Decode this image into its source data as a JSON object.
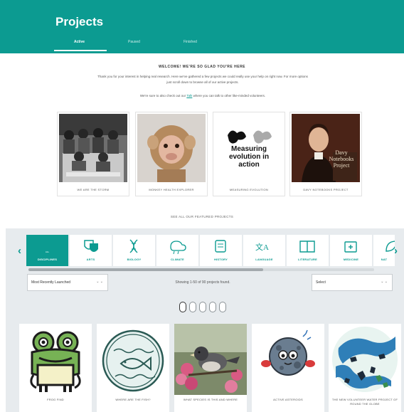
{
  "header": {
    "title": "Projects",
    "tabs": [
      {
        "label": "Active"
      },
      {
        "label": "Paused"
      },
      {
        "label": "Finished"
      }
    ]
  },
  "welcome": {
    "heading": "WELCOME! WE'RE SO GLAD YOU'RE HERE",
    "text": "Thank you for your interest in helping real research. Here we've gathered a few projects we could really use your help on right now. For more options just scroll down to browse all of our active projects.",
    "text2_before": "We're sure to also check out our",
    "text2_link": "Talk",
    "text2_after": "where you can talk to other like-minded volunteers."
  },
  "featured": [
    {
      "label": "WE ARE THE STORM"
    },
    {
      "label": "MONKEY HEALTH EXPLORER"
    },
    {
      "label": "MEASURING EVOLUTION",
      "image_title": "Measuring evolution in action"
    },
    {
      "label": "DAVY NOTEBOOKS PROJECT",
      "image_title": "Davy Notebooks Project"
    }
  ],
  "see_all": "SEE ALL OUR FEATURED PROJECTS",
  "disciplines": [
    {
      "label": "DISCIPLINES",
      "sub": "ALL",
      "icon": "all-icon",
      "active": true
    },
    {
      "label": "ARTS",
      "icon": "theater-masks-icon",
      "active": false
    },
    {
      "label": "BIOLOGY",
      "icon": "dna-icon",
      "active": false
    },
    {
      "label": "CLIMATE",
      "icon": "cloud-rain-icon",
      "active": false
    },
    {
      "label": "HISTORY",
      "icon": "scroll-icon",
      "active": false
    },
    {
      "label": "LANGUAGE",
      "icon": "language-icon",
      "active": false
    },
    {
      "label": "LITERATURE",
      "icon": "book-icon",
      "active": false
    },
    {
      "label": "MEDICINE",
      "icon": "medical-kit-icon",
      "active": false
    },
    {
      "label": "NAT",
      "icon": "leaf-icon",
      "active": false
    }
  ],
  "controls": {
    "sort": "Most Recently Launched",
    "showing": "Showing 1-50 of 90 projects found.",
    "language": "Select"
  },
  "colors": {
    "brand": "#0c9b91",
    "section_bg": "#e7ebee"
  },
  "projects": [
    {
      "label": "FROG FIND",
      "icon": "frog-icon"
    },
    {
      "label": "WHERE ARE THE FISH?",
      "icon": "fish-icon"
    },
    {
      "label": "WHAT SPECIES IS THIS AND WHERE"
    },
    {
      "label": "ACTIVE ASTEROIDS",
      "icon": "asteroid-icon"
    },
    {
      "label": "THE NEW VOLUNTEER WATER PROJECT OF ROUND THE GLOBE",
      "icon": "map-icon"
    }
  ]
}
